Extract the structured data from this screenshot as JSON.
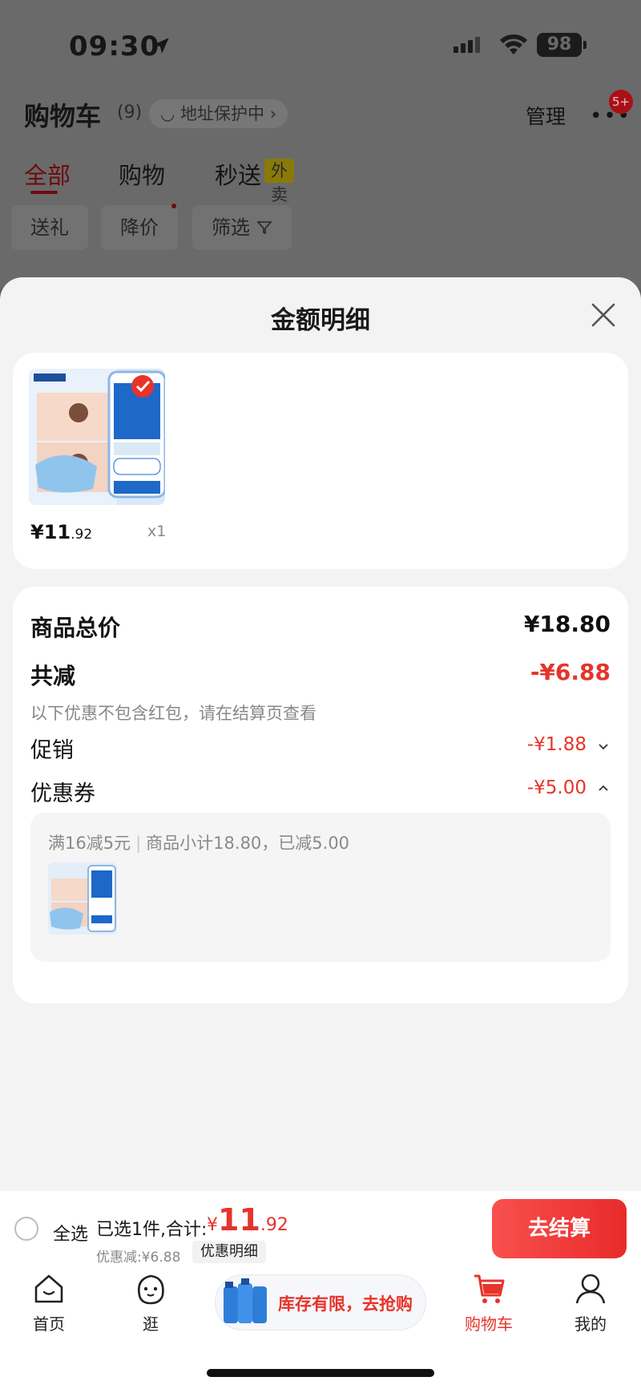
{
  "status_bar": {
    "time": "09:30",
    "battery": "98"
  },
  "header": {
    "title": "购物车",
    "count": "(9)",
    "address_chip": "地址保护中",
    "manage": "管理",
    "more_badge": "5+"
  },
  "tabs": [
    {
      "label": "全部"
    },
    {
      "label": "购物"
    },
    {
      "label": "秒送"
    }
  ],
  "takeout_badge": "外卖",
  "filters": [
    {
      "label": "送礼"
    },
    {
      "label": "降价"
    },
    {
      "label": "筛选"
    }
  ],
  "sheet": {
    "title": "金额明细",
    "product": {
      "price_int": "¥11",
      "price_dec": ".92",
      "qty": "x1"
    },
    "breakdown": {
      "total_label": "商品总价",
      "total_value": "¥18.80",
      "reduce_label": "共减",
      "reduce_value": "-¥6.88",
      "hint": "以下优惠不包含红包，请在结算页查看",
      "promo_label": "促销",
      "promo_value": "-¥1.88",
      "coupon_label": "优惠券",
      "coupon_value": "-¥5.00",
      "coupon_detail_rule": "满16减5元",
      "coupon_detail_sum": "商品小计18.80，已减5.00"
    }
  },
  "bottom_bar": {
    "select_all": "全选",
    "selected_prefix": "已选1件,合计:",
    "total_cur": "¥",
    "total_int": "11",
    "total_dec": ".92",
    "discount_line": "优惠减:¥6.88",
    "detail_chip": "优惠明细",
    "checkout": "去结算"
  },
  "nav": {
    "items": [
      {
        "label": "首页"
      },
      {
        "label": "逛"
      },
      {
        "label": "购物车"
      },
      {
        "label": "我的"
      }
    ],
    "promo_text": "库存有限，去抢购"
  },
  "colors": {
    "accent": "#e8332b",
    "sheet_bg": "#f3f3f4"
  }
}
